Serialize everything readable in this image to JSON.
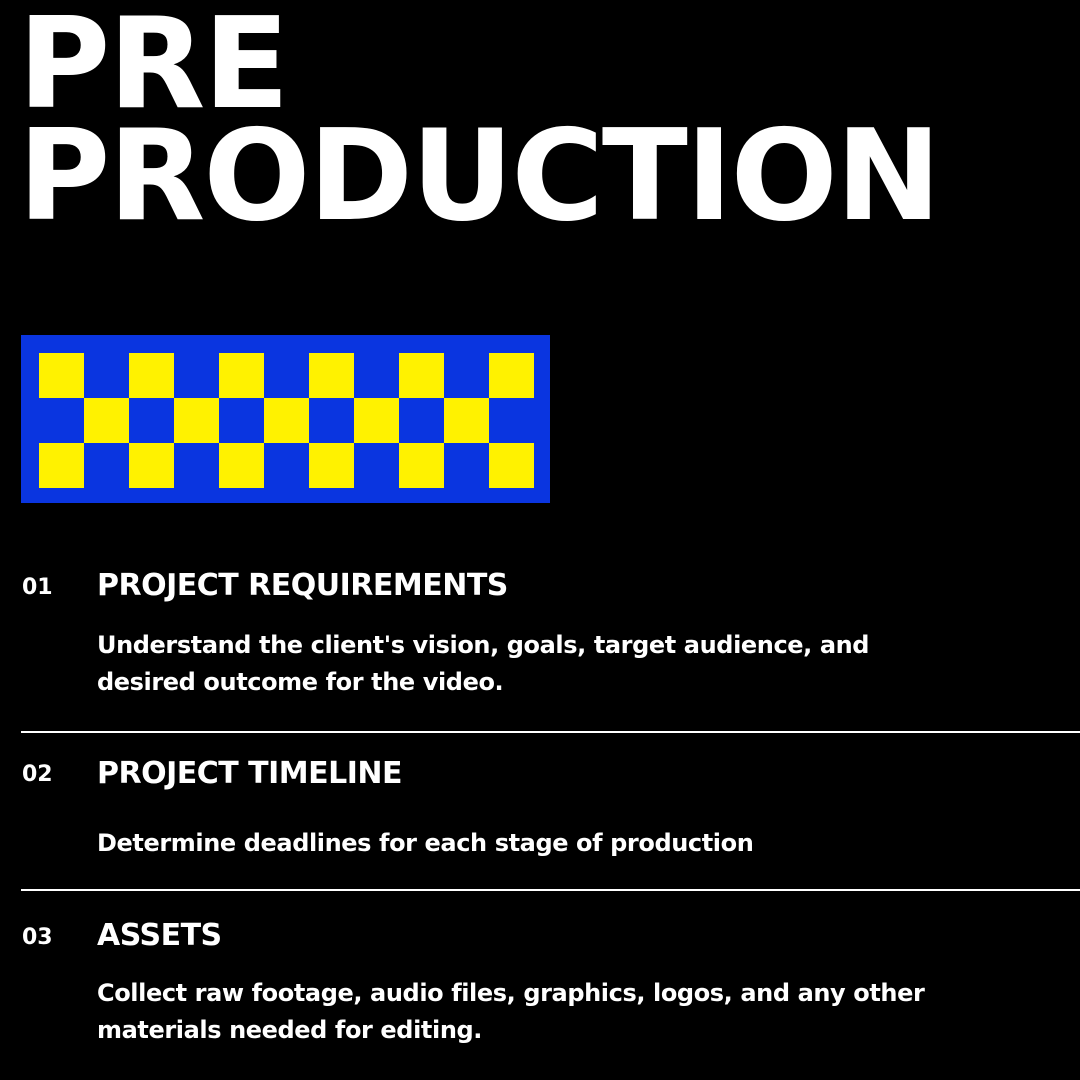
{
  "title": {
    "line1": "PRE",
    "line2": "PRODUCTION"
  },
  "colors": {
    "background": "#000000",
    "text": "#ffffff",
    "checker_blue": "#0a35e0",
    "checker_yellow": "#fff200"
  },
  "items": [
    {
      "number": "01",
      "heading": "PROJECT REQUIREMENTS",
      "description": "Understand the client's vision, goals, target audience, and desired outcome for the video."
    },
    {
      "number": "02",
      "heading": "PROJECT TIMELINE",
      "description": "Determine deadlines for each stage of production"
    },
    {
      "number": "03",
      "heading": "ASSETS",
      "description": "Collect raw footage, audio files, graphics, logos, and any other materials needed for editing."
    }
  ]
}
